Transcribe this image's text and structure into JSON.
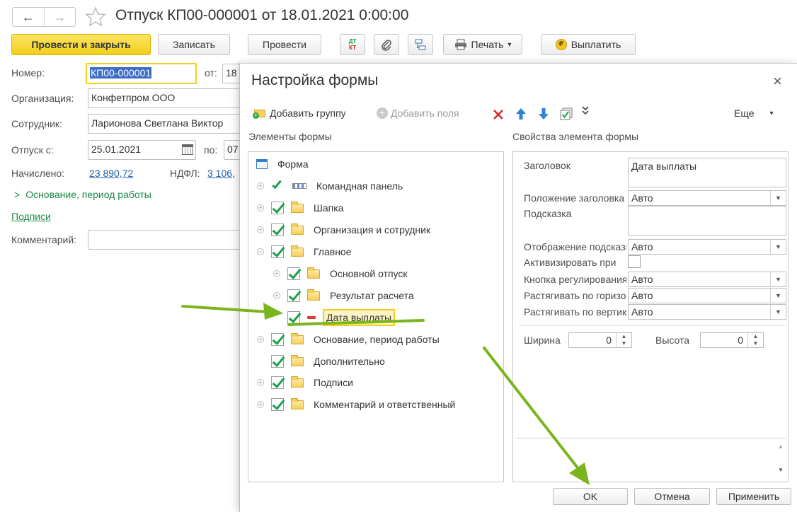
{
  "window": {
    "title": "Отпуск КП00-000001 от 18.01.2021 0:00:00",
    "nav": {
      "back": "←",
      "forward": "→"
    }
  },
  "toolbar": {
    "post_and_close": "Провести и закрыть",
    "save": "Записать",
    "post": "Провести",
    "dt_kt_top": "ДТ",
    "dt_kt_bottom": "КТ",
    "print": "Печать",
    "print_arrow": "▾",
    "pay": "Выплатить"
  },
  "form": {
    "number_label": "Номер:",
    "number_value": "КП00-000001",
    "from_label": "от:",
    "from_value": "18",
    "organization_label": "Организация:",
    "organization_value": "Конфетпром ООО",
    "employee_label": "Сотрудник:",
    "employee_value": "Ларионова Светлана Виктор",
    "vacation_from_label": "Отпуск с:",
    "vacation_from_value": "25.01.2021",
    "to_label": "по:",
    "to_value": "07",
    "accrued_label": "Начислено:",
    "accrued_value": "23 890,72",
    "ndfl_label": "НДФЛ:",
    "ndfl_value": "3 106,",
    "basis_group": "Основание, период работы",
    "signatures_link": "Подписи",
    "comment_label": "Комментарий:"
  },
  "dialog": {
    "title": "Настройка формы",
    "close": "×",
    "toolbar": {
      "add_group": "Добавить группу",
      "add_fields": "Добавить поля",
      "more": "Еще",
      "more_arrow": "▾"
    },
    "elements_heading": "Элементы формы",
    "properties_heading": "Свойства элемента формы",
    "tree": [
      {
        "label": "Форма",
        "level": 0,
        "expander": "",
        "checked": false,
        "icon": "form-icon"
      },
      {
        "label": "Командная панель",
        "level": 0,
        "expander": "+",
        "checked": true,
        "icon": "command-panel-icon"
      },
      {
        "label": "Шапка",
        "level": 0,
        "expander": "+",
        "checked": true,
        "icon": "folder-icon"
      },
      {
        "label": "Организация и сотрудник",
        "level": 0,
        "expander": "+",
        "checked": true,
        "icon": "folder-icon"
      },
      {
        "label": "Главное",
        "level": 0,
        "expander": "−",
        "checked": true,
        "icon": "folder-icon"
      },
      {
        "label": "Основной отпуск",
        "level": 1,
        "expander": "+",
        "checked": true,
        "icon": "folder-icon"
      },
      {
        "label": "Результат расчета",
        "level": 1,
        "expander": "+",
        "checked": true,
        "icon": "folder-icon"
      },
      {
        "label": "Дата выплаты",
        "level": 1,
        "expander": "",
        "checked": true,
        "icon": "field-icon",
        "selected": true
      },
      {
        "label": "Основание, период работы",
        "level": 0,
        "expander": "+",
        "checked": true,
        "icon": "folder-icon"
      },
      {
        "label": "Дополнительно",
        "level": 0,
        "expander": "",
        "checked": true,
        "icon": "folder-icon"
      },
      {
        "label": "Подписи",
        "level": 0,
        "expander": "+",
        "checked": true,
        "icon": "folder-icon"
      },
      {
        "label": "Комментарий и ответственный",
        "level": 0,
        "expander": "+",
        "checked": true,
        "icon": "folder-icon"
      }
    ],
    "properties": {
      "caption_label": "Заголовок",
      "caption_value": "Дата выплаты",
      "caption_position_label": "Положение заголовка",
      "caption_position_value": "Авто",
      "tooltip_label": "Подсказка",
      "tooltip_value": "",
      "tooltip_display_label": "Отображение подсказки",
      "tooltip_display_value": "Авто",
      "activate_label": "Активизировать при",
      "adjust_button_label": "Кнопка регулирования",
      "adjust_button_value": "Авто",
      "stretch_h_label": "Растягивать по горизонтали",
      "stretch_h_value": "Авто",
      "stretch_v_label": "Растягивать по вертикали",
      "stretch_v_value": "Авто",
      "width_label": "Ширина",
      "width_value": "0",
      "height_label": "Высота",
      "height_value": "0"
    },
    "buttons": {
      "ok": "OK",
      "cancel": "Отмена",
      "apply": "Применить"
    }
  },
  "colors": {
    "accent_yellow": "#f2cf1c",
    "arrow_green": "#7ab51d",
    "check_green": "#18a04a",
    "link_blue": "#1f5fa8"
  }
}
